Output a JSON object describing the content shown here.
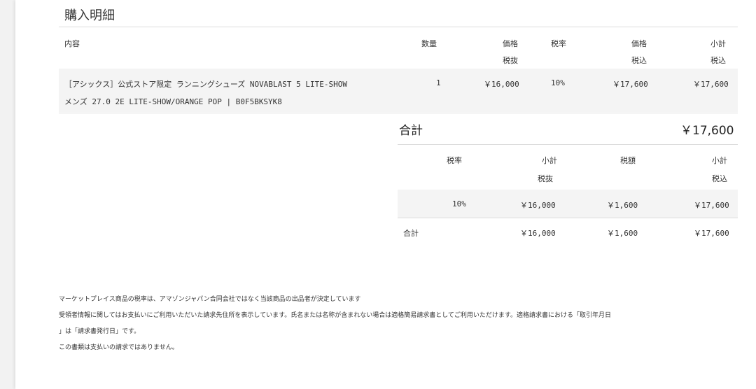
{
  "title": "購入明細",
  "table": {
    "headers": {
      "content": "内容",
      "qty": "数量",
      "price_ex_1": "価格",
      "price_ex_2": "税抜",
      "tax_rate": "税率",
      "price_in_1": "価格",
      "price_in_2": "税込",
      "subtotal_1": "小計",
      "subtotal_2": "税込"
    },
    "row": {
      "item_line1": "［アシックス］公式ストア限定 ランニングシューズ NOVABLAST 5 LITE-SHOW",
      "item_line2": "メンズ 27.0 2E LITE-SHOW/ORANGE POP | B0F5BKSYK8",
      "qty": "1",
      "price_ex": "￥16,000",
      "tax_rate": "10%",
      "price_in": "￥17,600",
      "subtotal": "￥17,600"
    }
  },
  "total": {
    "label": "合計",
    "value": "￥17,600"
  },
  "tax_table": {
    "headers": {
      "rate": "税率",
      "sub_ex_1": "小計",
      "sub_ex_2": "税抜",
      "tax": "税額",
      "sub_in_1": "小計",
      "sub_in_2": "税込"
    },
    "row": {
      "rate": "10%",
      "sub_ex": "￥16,000",
      "tax": "￥1,600",
      "sub_in": "￥17,600"
    },
    "total_row": {
      "label": "合計",
      "sub_ex": "￥16,000",
      "tax": "￥1,600",
      "sub_in": "￥17,600"
    }
  },
  "notes": [
    "マーケットプレイス商品の税率は、アマゾンジャパン合同会社ではなく当該商品の出品者が決定しています",
    "受領者情報に関してはお支払いにご利用いただいた請求先住所を表示しています。氏名または名称が含まれない場合は適格簡易請求書としてご利用いただけます。適格請求書における「取引年月日",
    "」は「請求書発行日」です。",
    "この書類は支払いの請求ではありません。"
  ]
}
